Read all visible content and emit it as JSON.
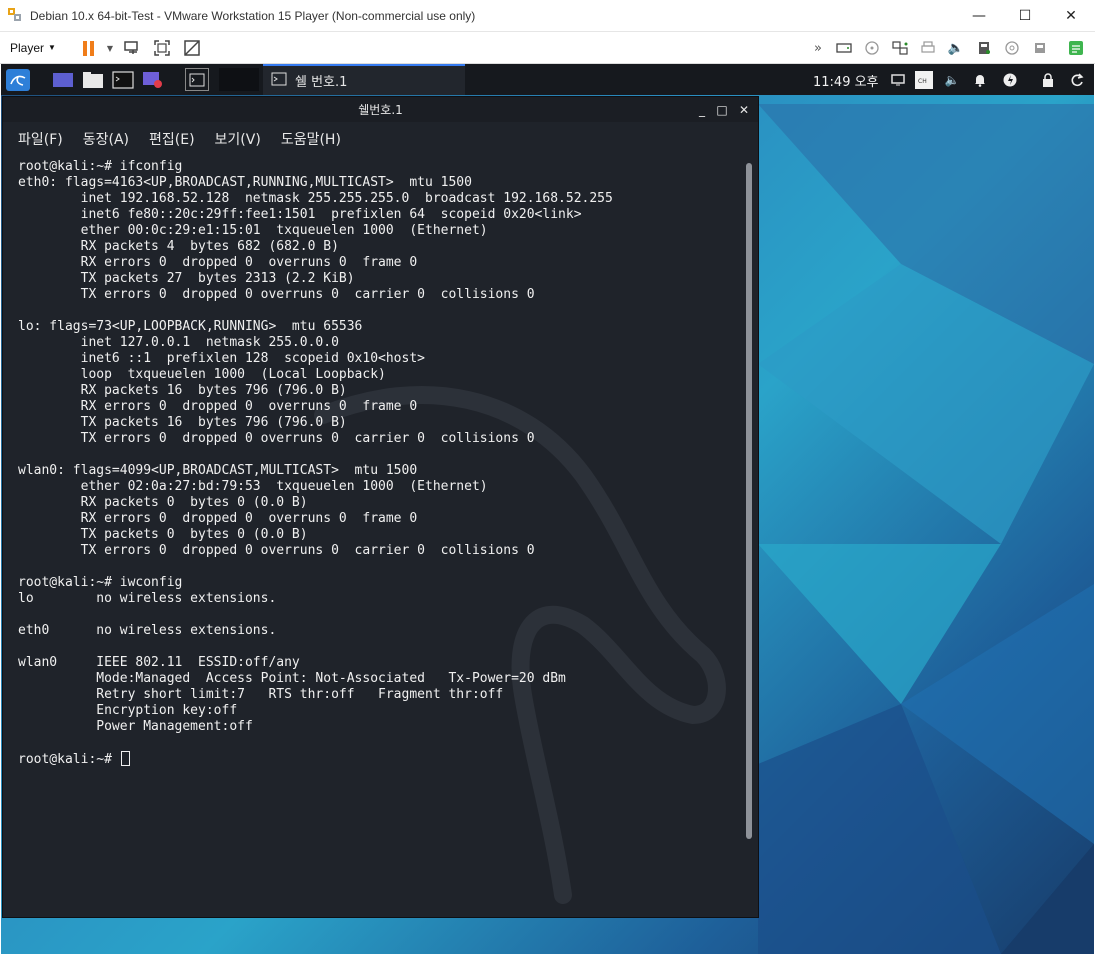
{
  "host": {
    "title": "Debian 10.x 64-bit-Test - VMware Workstation 15 Player (Non-commercial use only)",
    "player_menu": "Player",
    "window_controls": [
      "minimize-icon",
      "maximize-icon",
      "close-icon"
    ]
  },
  "toolbar_icons": [
    "pause-icon",
    "dropdown-icon",
    "send-ctrl-alt-del-icon",
    "fit-guest-icon",
    "unity-icon",
    "more-icon",
    "hard-disk-icon",
    "cd-drive-icon",
    "network-adapter-icon",
    "printer-icon",
    "sound-icon",
    "usb-icon",
    "disc-icon",
    "usb-device-icon",
    "message-log-icon"
  ],
  "kali_panel": {
    "taskbar_item": "쉘 번호.1",
    "clock": "11:49 오후"
  },
  "terminal": {
    "title": "쉘번호.1",
    "menu": [
      "파일(F)",
      "동장(A)",
      "편집(E)",
      "보기(V)",
      "도움말(H)"
    ],
    "lines": [
      "root@kali:~# ifconfig",
      "eth0: flags=4163<UP,BROADCAST,RUNNING,MULTICAST>  mtu 1500",
      "        inet 192.168.52.128  netmask 255.255.255.0  broadcast 192.168.52.255",
      "        inet6 fe80::20c:29ff:fee1:1501  prefixlen 64  scopeid 0x20<link>",
      "        ether 00:0c:29:e1:15:01  txqueuelen 1000  (Ethernet)",
      "        RX packets 4  bytes 682 (682.0 B)",
      "        RX errors 0  dropped 0  overruns 0  frame 0",
      "        TX packets 27  bytes 2313 (2.2 KiB)",
      "        TX errors 0  dropped 0 overruns 0  carrier 0  collisions 0",
      "",
      "lo: flags=73<UP,LOOPBACK,RUNNING>  mtu 65536",
      "        inet 127.0.0.1  netmask 255.0.0.0",
      "        inet6 ::1  prefixlen 128  scopeid 0x10<host>",
      "        loop  txqueuelen 1000  (Local Loopback)",
      "        RX packets 16  bytes 796 (796.0 B)",
      "        RX errors 0  dropped 0  overruns 0  frame 0",
      "        TX packets 16  bytes 796 (796.0 B)",
      "        TX errors 0  dropped 0 overruns 0  carrier 0  collisions 0",
      "",
      "wlan0: flags=4099<UP,BROADCAST,MULTICAST>  mtu 1500",
      "        ether 02:0a:27:bd:79:53  txqueuelen 1000  (Ethernet)",
      "        RX packets 0  bytes 0 (0.0 B)",
      "        RX errors 0  dropped 0  overruns 0  frame 0",
      "        TX packets 0  bytes 0 (0.0 B)",
      "        TX errors 0  dropped 0 overruns 0  carrier 0  collisions 0",
      "",
      "root@kali:~# iwconfig",
      "lo        no wireless extensions.",
      "",
      "eth0      no wireless extensions.",
      "",
      "wlan0     IEEE 802.11  ESSID:off/any",
      "          Mode:Managed  Access Point: Not-Associated   Tx-Power=20 dBm",
      "          Retry short limit:7   RTS thr:off   Fragment thr:off",
      "          Encryption key:off",
      "          Power Management:off",
      ""
    ],
    "prompt": "root@kali:~# "
  }
}
